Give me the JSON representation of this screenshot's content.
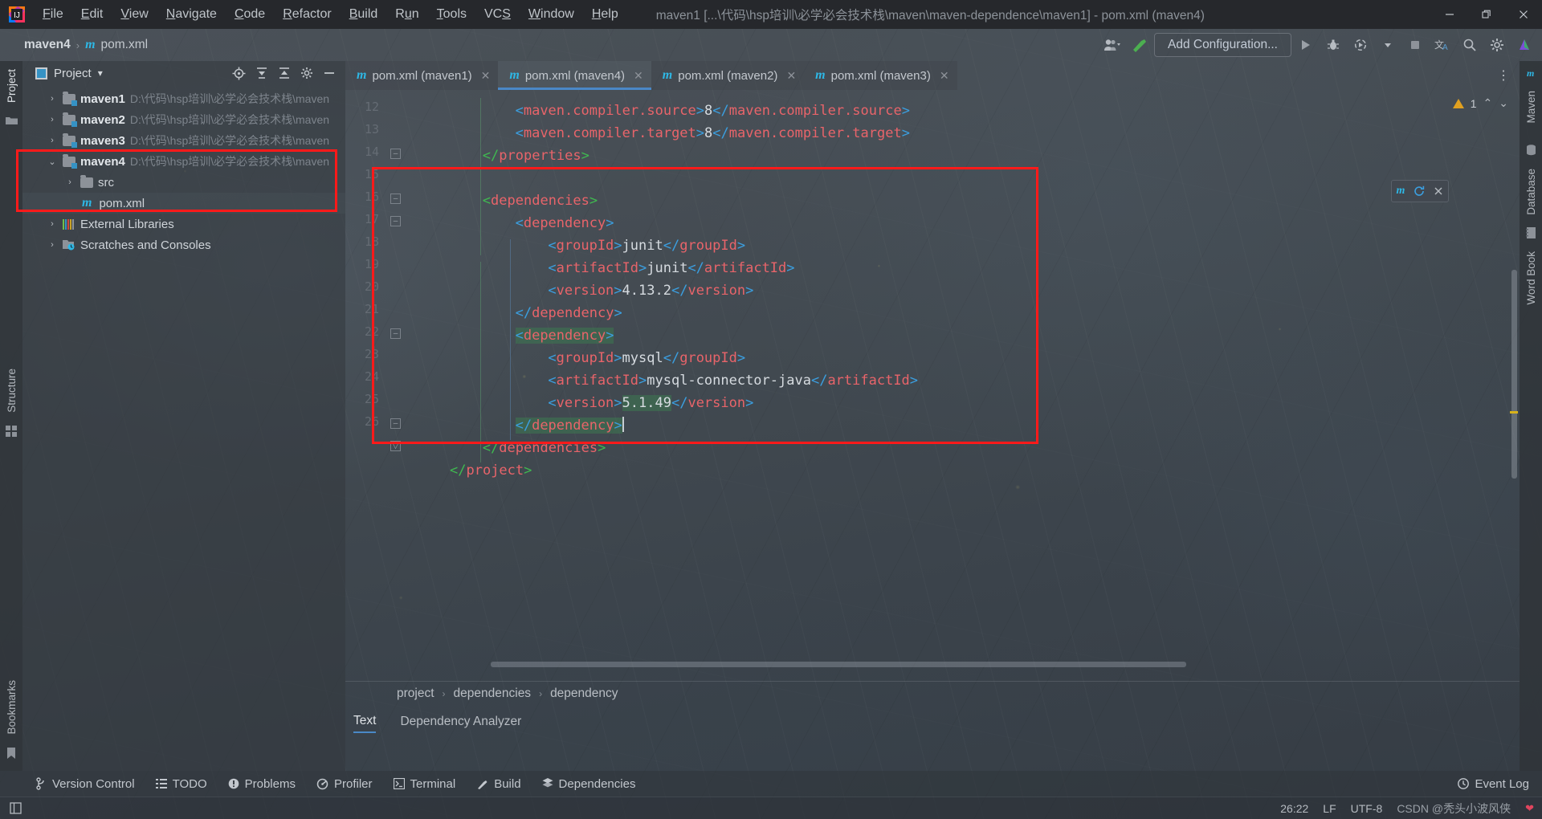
{
  "window": {
    "title": "maven1 [...\\代码\\hsp培训\\必学必会技术栈\\maven\\maven-dependence\\maven1] - pom.xml (maven4)",
    "minimize_label": "—",
    "maximize_label": "❐",
    "close_label": "✕",
    "logo_name": "intellij-idea-logo"
  },
  "menubar": {
    "items": [
      {
        "label": "File",
        "mnemonic": "F"
      },
      {
        "label": "Edit",
        "mnemonic": "E"
      },
      {
        "label": "View",
        "mnemonic": "V"
      },
      {
        "label": "Navigate",
        "mnemonic": "N"
      },
      {
        "label": "Code",
        "mnemonic": "C"
      },
      {
        "label": "Refactor",
        "mnemonic": "R"
      },
      {
        "label": "Build",
        "mnemonic": "B"
      },
      {
        "label": "Run",
        "mnemonic": "u"
      },
      {
        "label": "Tools",
        "mnemonic": "T"
      },
      {
        "label": "VCS",
        "mnemonic": "S"
      },
      {
        "label": "Window",
        "mnemonic": "W"
      },
      {
        "label": "Help",
        "mnemonic": "H"
      }
    ]
  },
  "navbar": {
    "breadcrumbs": [
      {
        "label": "maven4",
        "icon": "module-icon"
      },
      {
        "label": "pom.xml",
        "icon": "maven-m-icon"
      }
    ],
    "separator": "›",
    "add_configuration_label": "Add Configuration...",
    "icons": [
      "user-avatar-icon",
      "chevron-down-icon",
      "build-hammer-icon",
      "run-icon",
      "debug-icon",
      "run-with-coverage-icon",
      "chevron-down-icon",
      "stop-icon",
      "translate-icon",
      "search-icon",
      "settings-gear-icon",
      "idea-assistant-icon"
    ]
  },
  "left_strip": {
    "tabs": [
      "Project",
      "Structure",
      "Bookmarks"
    ],
    "selected": "Project",
    "icons": [
      "folder-icon",
      "structure-icon",
      "bookmark-icon"
    ]
  },
  "right_strip": {
    "tabs": [
      "Maven",
      "Database",
      "Word Book"
    ],
    "icons": [
      "maven-icon",
      "database-icon",
      "notebook-icon"
    ]
  },
  "project_panel": {
    "title": "Project",
    "dropdown": "▾",
    "header_icons": [
      "locate-icon",
      "expand-all-icon",
      "collapse-all-icon",
      "settings-gear-icon",
      "hide-icon"
    ],
    "tree": [
      {
        "arrow": "›",
        "label": "maven1",
        "path": "D:\\代码\\hsp培训\\必学必会技术栈\\maven",
        "icon": "module-folder-icon",
        "indent": 0
      },
      {
        "arrow": "›",
        "label": "maven2",
        "path": "D:\\代码\\hsp培训\\必学必会技术栈\\maven",
        "icon": "module-folder-icon",
        "indent": 0
      },
      {
        "arrow": "›",
        "label": "maven3",
        "path": "D:\\代码\\hsp培训\\必学必会技术栈\\maven",
        "icon": "module-folder-icon",
        "indent": 0
      },
      {
        "arrow": "⌄",
        "label": "maven4",
        "path": "D:\\代码\\hsp培训\\必学必会技术栈\\maven",
        "icon": "module-folder-icon",
        "indent": 0
      },
      {
        "arrow": "›",
        "label": "src",
        "path": "",
        "icon": "folder-icon",
        "indent": 1
      },
      {
        "arrow": "",
        "label": "pom.xml",
        "path": "",
        "icon": "maven-m-icon",
        "indent": 2
      },
      {
        "arrow": "›",
        "label": "External Libraries",
        "path": "",
        "icon": "libraries-icon",
        "indent": 0
      },
      {
        "arrow": "›",
        "label": "Scratches and Consoles",
        "path": "",
        "icon": "scratches-icon",
        "indent": 0
      }
    ]
  },
  "editor": {
    "tabs": [
      {
        "label": "pom.xml (maven1)",
        "icon": "maven-m-icon",
        "active": false,
        "close": "✕"
      },
      {
        "label": "pom.xml (maven4)",
        "icon": "maven-m-icon",
        "active": true,
        "close": "✕"
      },
      {
        "label": "pom.xml (maven2)",
        "icon": "maven-m-icon",
        "active": false,
        "close": "✕"
      },
      {
        "label": "pom.xml (maven3)",
        "icon": "maven-m-icon",
        "active": false,
        "close": "✕"
      }
    ],
    "more_tabs_icon": "vertical-dots-icon",
    "inspection": {
      "warning_count": "1",
      "up": "⌃",
      "down": "⌄",
      "icon": "warning-triangle-icon"
    },
    "lines": [
      {
        "no": "12",
        "indent": 8,
        "tokens": [
          {
            "t": "brk",
            "v": "<"
          },
          {
            "t": "tag",
            "v": "maven.compiler.source"
          },
          {
            "t": "brk",
            "v": ">"
          },
          {
            "t": "val",
            "v": "8"
          },
          {
            "t": "brk",
            "v": "</"
          },
          {
            "t": "tag",
            "v": "maven.compiler.source"
          },
          {
            "t": "brk",
            "v": ">"
          }
        ]
      },
      {
        "no": "13",
        "indent": 8,
        "tokens": [
          {
            "t": "brk",
            "v": "<"
          },
          {
            "t": "tag",
            "v": "maven.compiler.target"
          },
          {
            "t": "brk",
            "v": ">"
          },
          {
            "t": "val",
            "v": "8"
          },
          {
            "t": "brk",
            "v": "</"
          },
          {
            "t": "tag",
            "v": "maven.compiler.target"
          },
          {
            "t": "brk",
            "v": ">"
          }
        ]
      },
      {
        "no": "14",
        "indent": 4,
        "tokens": [
          {
            "t": "grn",
            "v": "</"
          },
          {
            "t": "tag",
            "v": "properties"
          },
          {
            "t": "grn",
            "v": ">"
          }
        ]
      },
      {
        "no": "15",
        "indent": 0,
        "tokens": []
      },
      {
        "no": "16",
        "indent": 4,
        "tokens": [
          {
            "t": "grn",
            "v": "<"
          },
          {
            "t": "tag",
            "v": "dependencies"
          },
          {
            "t": "grn",
            "v": ">"
          }
        ]
      },
      {
        "no": "17",
        "indent": 8,
        "tokens": [
          {
            "t": "brk",
            "v": "<"
          },
          {
            "t": "tag",
            "v": "dependency"
          },
          {
            "t": "brk",
            "v": ">"
          }
        ]
      },
      {
        "no": "18",
        "indent": 12,
        "tokens": [
          {
            "t": "brk",
            "v": "<"
          },
          {
            "t": "tag",
            "v": "groupId"
          },
          {
            "t": "brk",
            "v": ">"
          },
          {
            "t": "val",
            "v": "junit"
          },
          {
            "t": "brk",
            "v": "</"
          },
          {
            "t": "tag",
            "v": "groupId"
          },
          {
            "t": "brk",
            "v": ">"
          }
        ]
      },
      {
        "no": "19",
        "indent": 12,
        "tokens": [
          {
            "t": "brk",
            "v": "<"
          },
          {
            "t": "tag",
            "v": "artifactId"
          },
          {
            "t": "brk",
            "v": ">"
          },
          {
            "t": "val",
            "v": "junit"
          },
          {
            "t": "brk",
            "v": "</"
          },
          {
            "t": "tag",
            "v": "artifactId"
          },
          {
            "t": "brk",
            "v": ">"
          }
        ]
      },
      {
        "no": "20",
        "indent": 12,
        "tokens": [
          {
            "t": "brk",
            "v": "<"
          },
          {
            "t": "tag",
            "v": "version"
          },
          {
            "t": "brk",
            "v": ">"
          },
          {
            "t": "val",
            "v": "4.13.2"
          },
          {
            "t": "brk",
            "v": "</"
          },
          {
            "t": "tag",
            "v": "version"
          },
          {
            "t": "brk",
            "v": ">"
          }
        ]
      },
      {
        "no": "21",
        "indent": 8,
        "tokens": [
          {
            "t": "brk",
            "v": "</"
          },
          {
            "t": "tag",
            "v": "dependency"
          },
          {
            "t": "brk",
            "v": ">"
          }
        ]
      },
      {
        "no": "22",
        "indent": 8,
        "hl": true,
        "tokens": [
          {
            "t": "brk",
            "v": "<"
          },
          {
            "t": "tag",
            "v": "dependency"
          },
          {
            "t": "brk",
            "v": ">"
          }
        ]
      },
      {
        "no": "23",
        "indent": 12,
        "tokens": [
          {
            "t": "brk",
            "v": "<"
          },
          {
            "t": "tag",
            "v": "groupId"
          },
          {
            "t": "brk",
            "v": ">"
          },
          {
            "t": "val",
            "v": "mysql"
          },
          {
            "t": "brk",
            "v": "</"
          },
          {
            "t": "tag",
            "v": "groupId"
          },
          {
            "t": "brk",
            "v": ">"
          }
        ]
      },
      {
        "no": "24",
        "indent": 12,
        "tokens": [
          {
            "t": "brk",
            "v": "<"
          },
          {
            "t": "tag",
            "v": "artifactId"
          },
          {
            "t": "brk",
            "v": ">"
          },
          {
            "t": "val",
            "v": "mysql-connector-java"
          },
          {
            "t": "brk",
            "v": "</"
          },
          {
            "t": "tag",
            "v": "artifactId"
          },
          {
            "t": "brk",
            "v": ">"
          }
        ]
      },
      {
        "no": "25",
        "indent": 12,
        "tokens": [
          {
            "t": "brk",
            "v": "<"
          },
          {
            "t": "tag",
            "v": "version"
          },
          {
            "t": "brk",
            "v": ">"
          },
          {
            "t": "val",
            "v": "5.1.49",
            "hl": true
          },
          {
            "t": "brk",
            "v": "</"
          },
          {
            "t": "tag",
            "v": "version"
          },
          {
            "t": "brk",
            "v": ">"
          }
        ]
      },
      {
        "no": "26",
        "indent": 8,
        "hl": true,
        "caret": true,
        "tokens": [
          {
            "t": "brk",
            "v": "</"
          },
          {
            "t": "tag",
            "v": "dependency"
          },
          {
            "t": "brk",
            "v": ">"
          }
        ]
      },
      {
        "no": "",
        "indent": 4,
        "tokens": [
          {
            "t": "grn",
            "v": "</"
          },
          {
            "t": "tag",
            "v": "dependencies"
          },
          {
            "t": "grn",
            "v": ">"
          }
        ]
      },
      {
        "no": "",
        "indent": 0,
        "tokens": [
          {
            "t": "grn",
            "v": "</"
          },
          {
            "t": "tag",
            "v": "project"
          },
          {
            "t": "grn",
            "v": ">"
          }
        ]
      }
    ],
    "breadcrumbs": [
      "project",
      "dependencies",
      "dependency"
    ],
    "breadcrumb_sep": "›",
    "bottom_tabs": [
      {
        "label": "Text",
        "active": true
      },
      {
        "label": "Dependency Analyzer",
        "active": false
      }
    ]
  },
  "toolwindow_bar": {
    "items": [
      {
        "label": "Version Control",
        "icon": "vcs-branch-icon"
      },
      {
        "label": "TODO",
        "icon": "todo-list-icon"
      },
      {
        "label": "Problems",
        "icon": "problems-icon"
      },
      {
        "label": "Profiler",
        "icon": "profiler-icon"
      },
      {
        "label": "Terminal",
        "icon": "terminal-icon"
      },
      {
        "label": "Build",
        "icon": "build-hammer-icon"
      },
      {
        "label": "Dependencies",
        "icon": "dependencies-icon"
      }
    ],
    "right": [
      {
        "label": "Event Log",
        "icon": "event-log-icon"
      }
    ]
  },
  "statusbar": {
    "left_icon": "hide-toolwindows-icon",
    "caret_position": "26:22",
    "line_separator": "LF",
    "encoding": "UTF-8",
    "watermark": "CSDN @秃头小波风侠"
  },
  "colors": {
    "accent_blue": "#3592c4",
    "tag_red": "#e8646a",
    "bracket_blue": "#3b9fe0",
    "green": "#3fb950",
    "highlight_red": "#ff1a1a",
    "warning_amber": "#e0a020"
  }
}
